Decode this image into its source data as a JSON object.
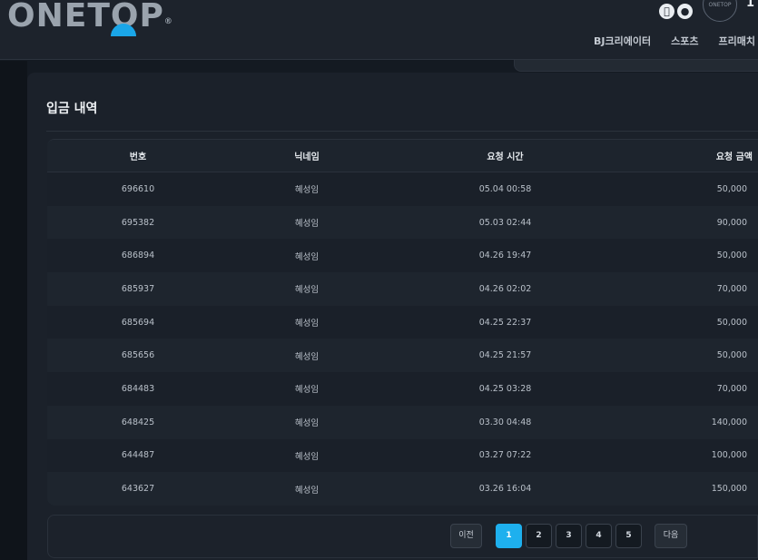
{
  "header": {
    "logo_text": "ONETOP",
    "logo_mark": "®",
    "avatar_text": "ONETOP",
    "user_number": "1",
    "apple_icon": "apple-icon",
    "android_icon": "android-icon",
    "nav": [
      "BJ크리에이터",
      "스포츠",
      "프리매치"
    ]
  },
  "page": {
    "title": "입금 내역"
  },
  "table": {
    "columns": [
      "번호",
      "닉네임",
      "요청 시간",
      "요청 금액"
    ],
    "rows": [
      [
        "696610",
        "혜성임",
        "05.04 00:58",
        "50,000"
      ],
      [
        "695382",
        "혜성임",
        "05.03 02:44",
        "90,000"
      ],
      [
        "686894",
        "혜성임",
        "04.26 19:47",
        "50,000"
      ],
      [
        "685937",
        "혜성임",
        "04.26 02:02",
        "70,000"
      ],
      [
        "685694",
        "혜성임",
        "04.25 22:37",
        "50,000"
      ],
      [
        "685656",
        "혜성임",
        "04.25 21:57",
        "50,000"
      ],
      [
        "684483",
        "혜성임",
        "04.25 03:28",
        "70,000"
      ],
      [
        "648425",
        "혜성임",
        "03.30 04:48",
        "140,000"
      ],
      [
        "644487",
        "혜성임",
        "03.27 07:22",
        "100,000"
      ],
      [
        "643627",
        "혜성임",
        "03.26 16:04",
        "150,000"
      ]
    ]
  },
  "pagination": {
    "prev": "이전",
    "pages": [
      "1",
      "2",
      "3",
      "4",
      "5"
    ],
    "current": "1",
    "next": "다음"
  },
  "colors": {
    "accent": "#1eb0ee",
    "background": "#141a22"
  }
}
